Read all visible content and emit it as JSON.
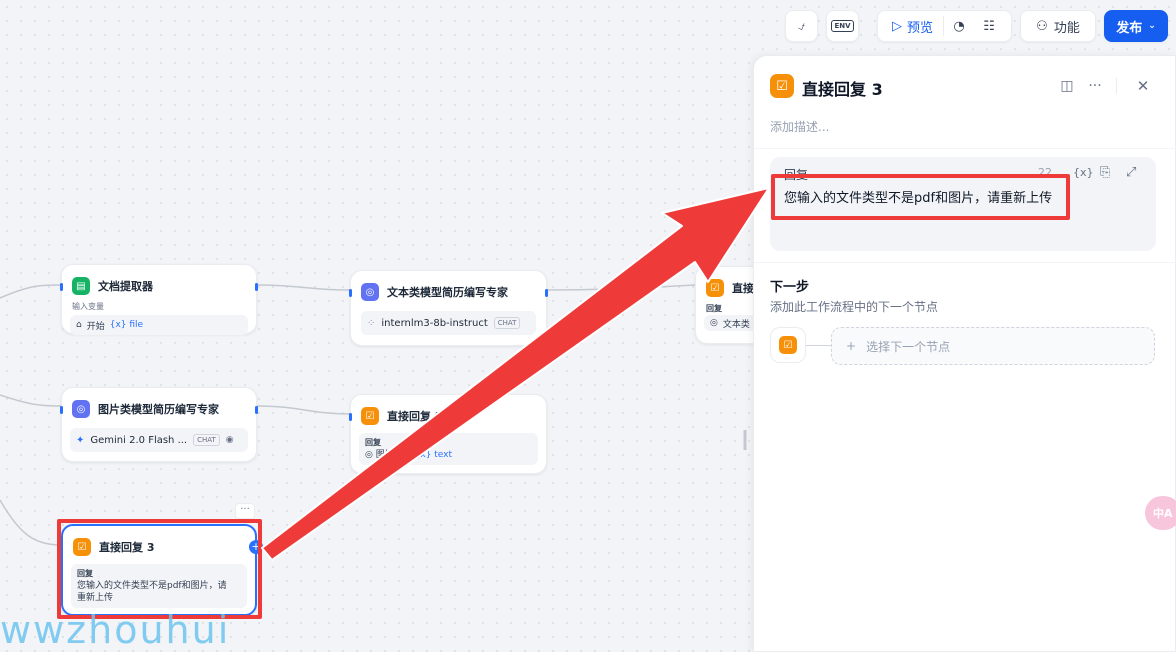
{
  "toolbar": {
    "preview_label": "预览",
    "features_label": "功能",
    "publish_label": "发布",
    "env_label": "ENV"
  },
  "nodes": {
    "doc_extractor": {
      "title": "文档提取器",
      "input_label": "输入变量",
      "source": "开始",
      "var": "{x} file"
    },
    "text_model": {
      "title": "文本类模型简历编写专家",
      "model": "internlm3-8b-instruct",
      "tag": "CHAT"
    },
    "partial_reply": {
      "title": "直接",
      "label": "回复",
      "snippet": "文本类"
    },
    "image_model": {
      "title": "图片类模型简历编写专家",
      "model": "Gemini 2.0 Flash ...",
      "tag": "CHAT"
    },
    "reply2": {
      "title": "直接回复 2",
      "label": "回复",
      "source": "图片类模",
      "var": "{x} text"
    },
    "reply3": {
      "title": "直接回复 3",
      "label": "回复",
      "text_line1": "您输入的文件类型不是pdf和图片，请",
      "text_line2": "重新上传"
    }
  },
  "panel": {
    "title": "直接回复 3",
    "description_placeholder": "添加描述...",
    "reply_label": "回复",
    "reply_count": "22",
    "var_icon_label": "{x}",
    "reply_text": "您输入的文件类型不是pdf和图片，请重新上传",
    "next_step_title": "下一步",
    "next_step_desc": "添加此工作流程中的下一个节点",
    "select_next_label": "选择下一个节点"
  },
  "colors": {
    "accent": "#155eef",
    "annotation_red": "#ef3a3a",
    "reply_node_orange": "#f79009"
  },
  "watermark": "wwzhouhui",
  "translate_fab": "中A"
}
